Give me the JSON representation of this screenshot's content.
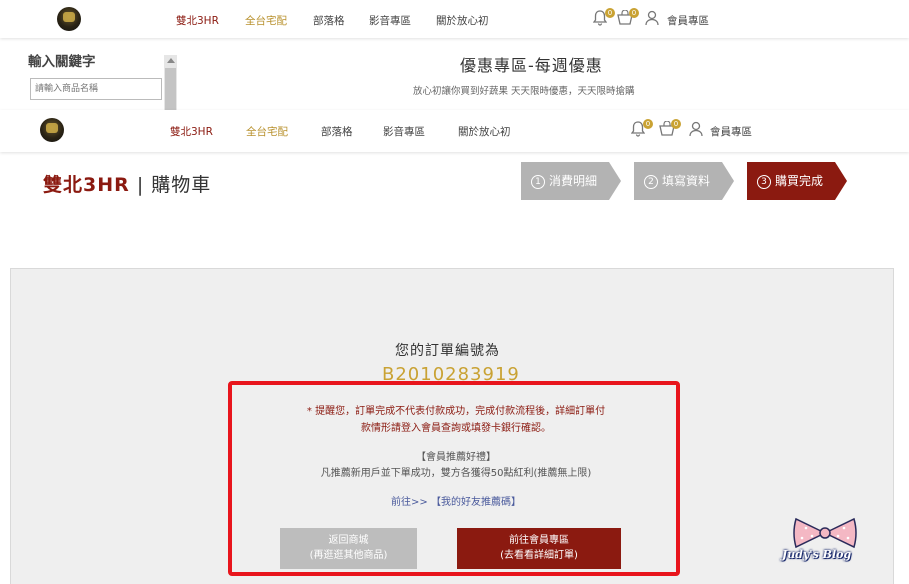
{
  "nav": {
    "items": [
      "雙北3HR",
      "全台宅配",
      "部落格",
      "影音專區",
      "關於放心初"
    ],
    "cart_badge": "0",
    "favorite_badge": "0",
    "member": "會員專區"
  },
  "search": {
    "title": "輸入關鍵字",
    "placeholder": "請輸入商品名稱"
  },
  "promo": {
    "title": "優惠專區-每週優惠",
    "subtitle": "放心初讓你買到好蔬果 天天限時優惠，天天限時搶購"
  },
  "cart": {
    "region": "雙北3HR",
    "separator": "|",
    "title": "購物車"
  },
  "steps": [
    {
      "num": "1",
      "label": "消費明細"
    },
    {
      "num": "2",
      "label": "填寫資料"
    },
    {
      "num": "3",
      "label": "購買完成"
    }
  ],
  "order": {
    "label": "您的訂單編號為",
    "number": "B2010283919",
    "notice_line1": "* 提醒您，訂單完成不代表付款成功，完成付款流程後，詳細訂單付",
    "notice_line2": "款情形請登入會員查詢或填發卡銀行確認。",
    "referral_title": "【會員推薦好禮】",
    "referral_desc": "凡推薦新用戶並下單成功，雙方各獲得50點紅利(推薦無上限)",
    "referral_prefix": "前往>>",
    "referral_link": "【我的好友推薦碼】",
    "back_line1": "返回商城",
    "back_line2": "(再逛逛其他商品)",
    "member_line1": "前往會員專區",
    "member_line2": "(去看看詳細訂單)"
  },
  "watermark": {
    "text": "Judy's Blog"
  },
  "colors": {
    "brand_red": "#8b1a10",
    "gold": "#c9a233",
    "highlight": "#e8151c"
  }
}
